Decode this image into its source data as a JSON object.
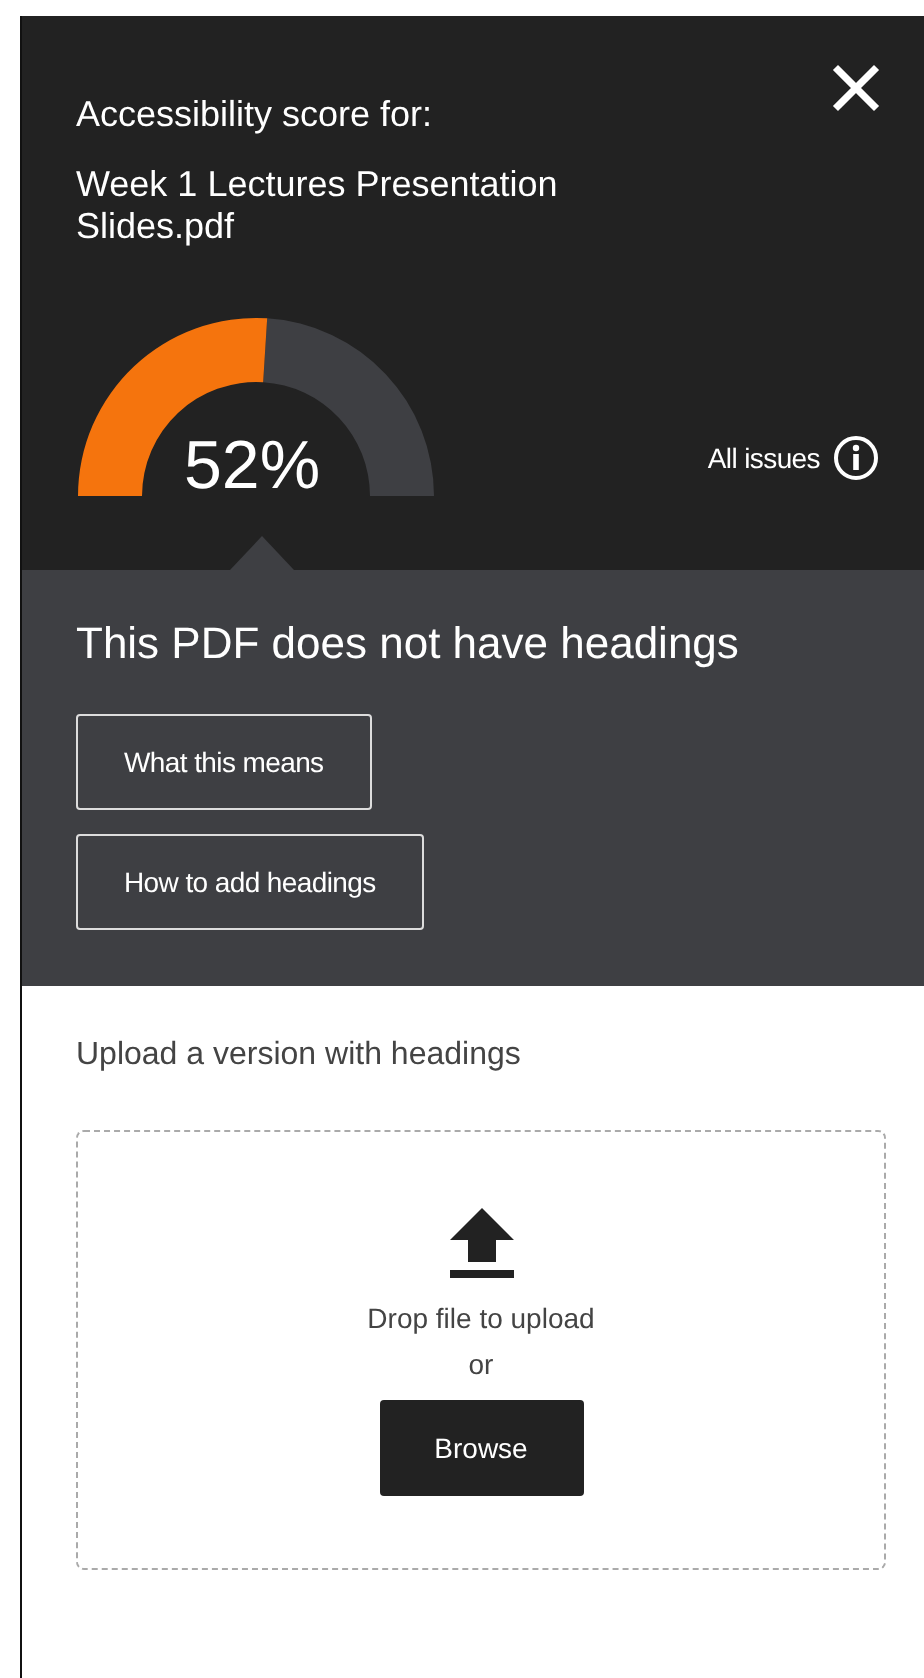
{
  "header": {
    "title": "Accessibility score for:",
    "file_name": "Week 1 Lectures Presentation Slides.pdf"
  },
  "score": {
    "reading": "52%"
  },
  "all_issues": {
    "label": "All issues"
  },
  "issue": {
    "title": "This PDF does not have headings",
    "buttons": [
      "What this means",
      "How to add headings"
    ]
  },
  "upload": {
    "label": "Upload a version with headings",
    "drop_text": "Drop file to upload",
    "or_text": "or",
    "button": "Browse"
  }
}
